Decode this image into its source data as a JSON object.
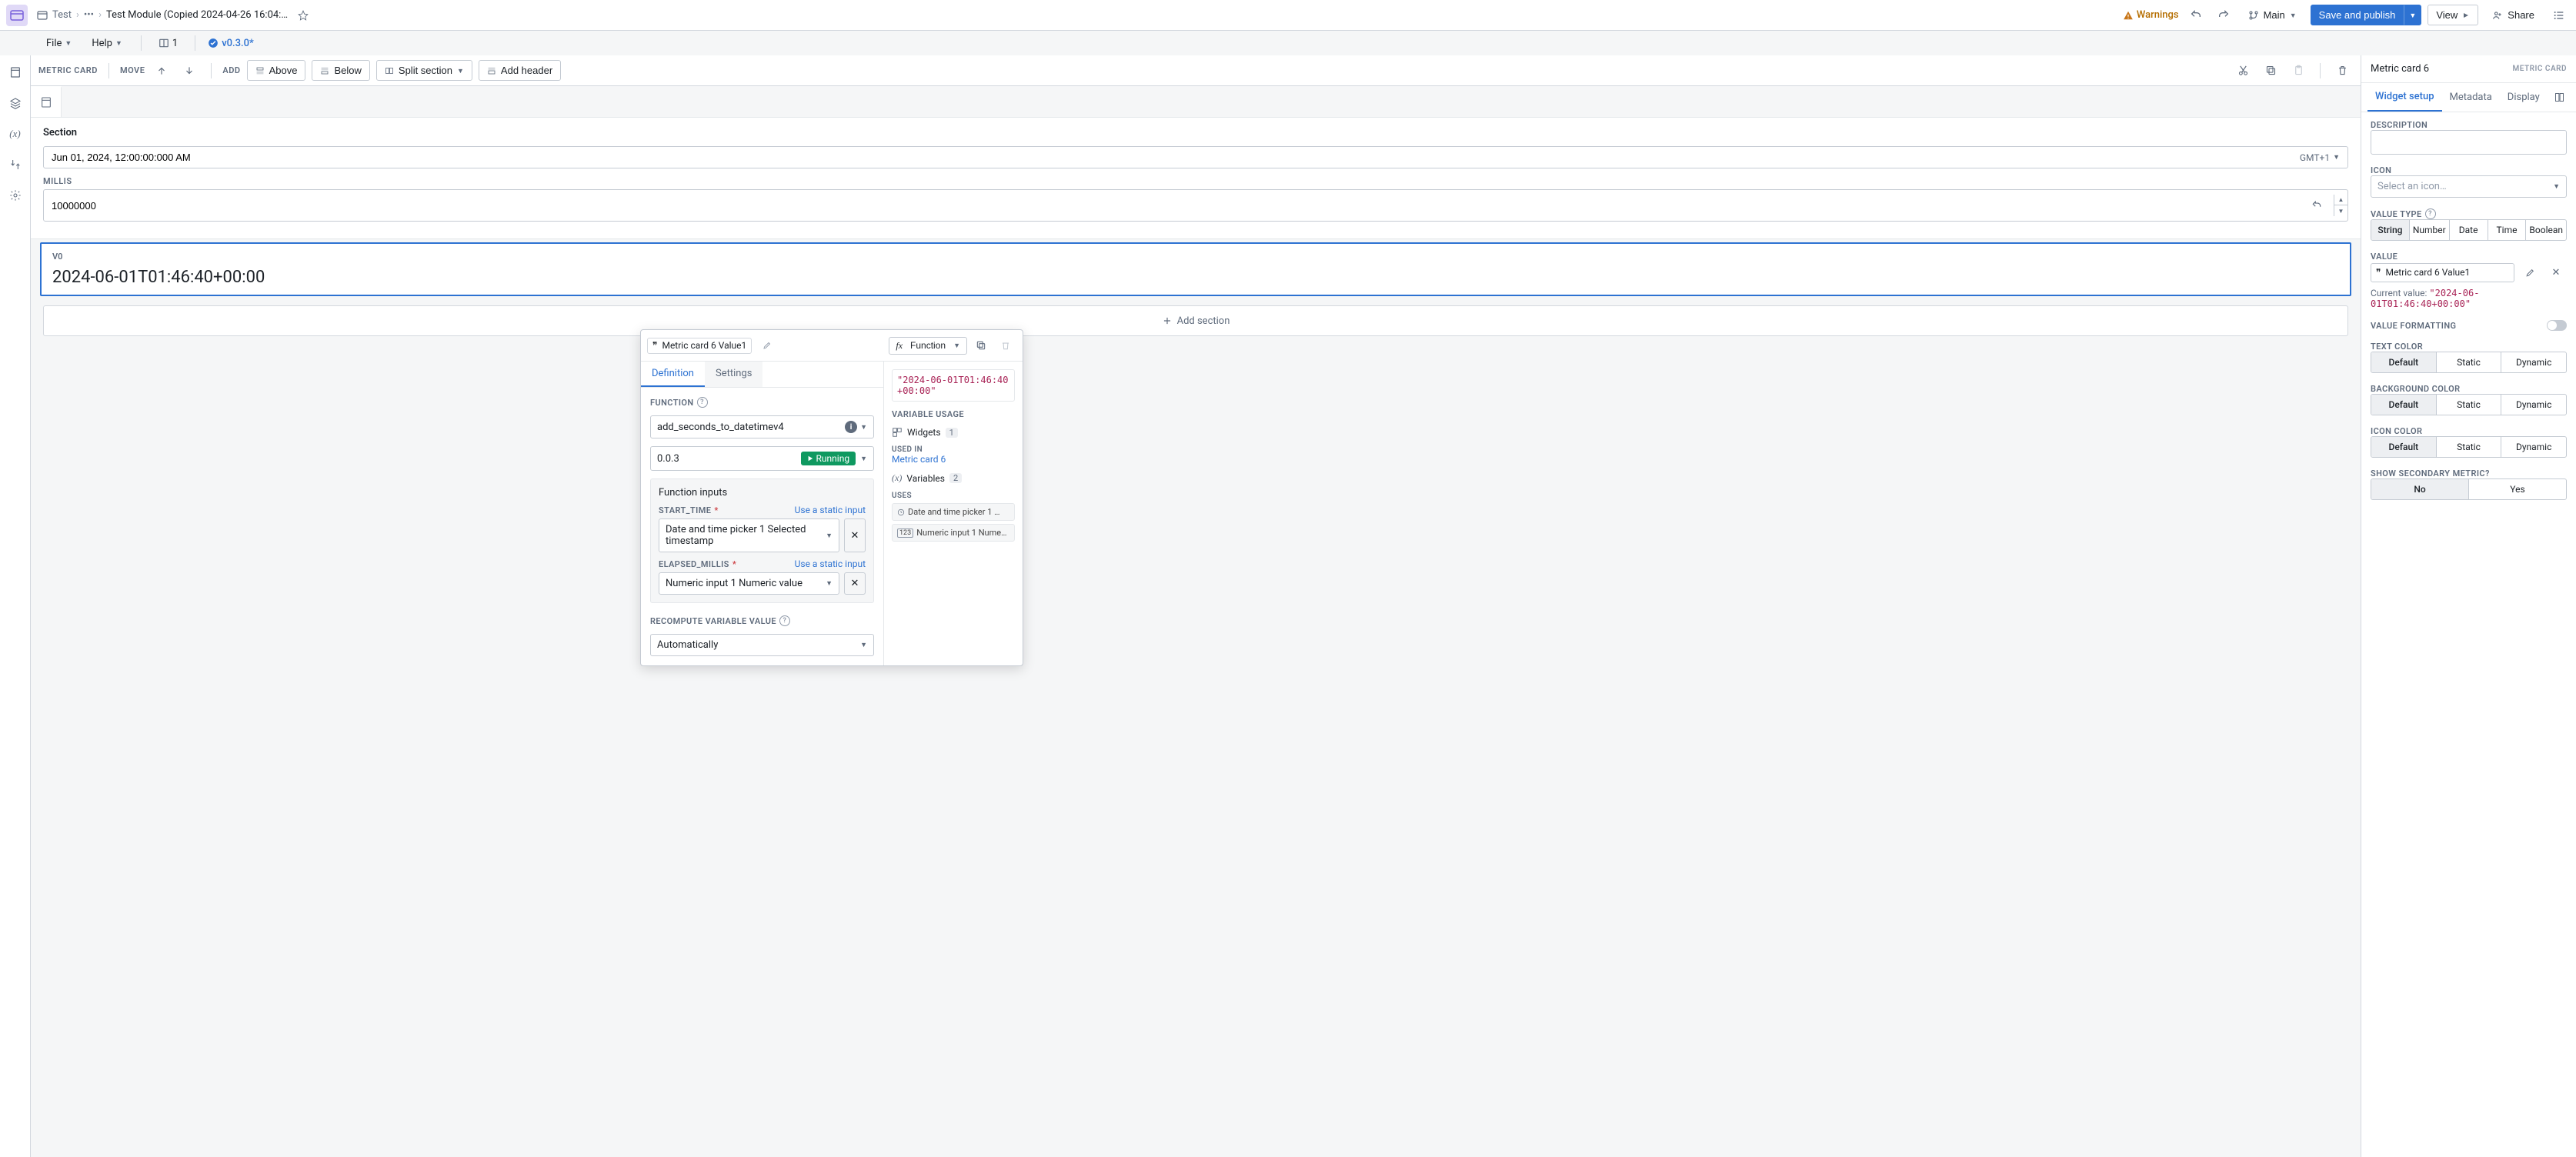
{
  "breadcrumb": {
    "proj": "Test",
    "ellipsis": "•••",
    "module": "Test Module (Copied 2024-04-26 16:04:…"
  },
  "menu": {
    "file": "File",
    "help": "Help",
    "panes": "1",
    "version": "v0.3.0*"
  },
  "header": {
    "warnings": "Warnings",
    "branch": "Main",
    "save": "Save and publish",
    "view": "View",
    "share": "Share"
  },
  "toolbar": {
    "widget": "METRIC CARD",
    "move": "MOVE",
    "add": "ADD",
    "above": "Above",
    "below": "Below",
    "split": "Split section",
    "header": "Add header"
  },
  "section": {
    "title": "Section",
    "date_value": "Jun 01, 2024, 12:00:00:000 AM",
    "tz": "GMT+1",
    "millis_label": "MILLIS",
    "millis_value": "10000000",
    "v0_label": "V0",
    "v0_value": "2024-06-01T01:46:40+00:00",
    "add_section": "Add section"
  },
  "popover": {
    "title": "Metric card 6 Value1",
    "type_label": "Function",
    "tabs": {
      "def": "Definition",
      "settings": "Settings"
    },
    "function_label": "FUNCTION",
    "function_name": "add_seconds_to_datetimev4",
    "version": "0.0.3",
    "running": "Running",
    "inputs_title": "Function inputs",
    "start_time_label": "START_TIME",
    "start_time_value": "Date and time picker 1 Selected timestamp",
    "use_static": "Use a static input",
    "elapsed_label": "ELAPSED_MILLIS",
    "elapsed_value": "Numeric input 1 Numeric value",
    "recompute_label": "RECOMPUTE VARIABLE VALUE",
    "recompute_value": "Automatically",
    "eval_value": "\"2024-06-01T01:46:40+00:00\"",
    "usage_label": "VARIABLE USAGE",
    "widgets_label": "Widgets",
    "widgets_count": "1",
    "used_in": "USED IN",
    "used_in_link": "Metric card 6",
    "variables_label": "Variables",
    "variables_count": "2",
    "uses_label": "USES",
    "uses_1": "Date and time picker 1 …",
    "uses_2": "Numeric input 1 Nume…"
  },
  "rightpanel": {
    "title": "Metric card 6",
    "type": "METRIC CARD",
    "tabs": {
      "widget": "Widget setup",
      "metadata": "Metadata",
      "display": "Display"
    },
    "desc_label": "DESCRIPTION",
    "icon_label": "ICON",
    "icon_placeholder": "Select an icon…",
    "valuetype_label": "VALUE TYPE",
    "vt": {
      "string": "String",
      "number": "Number",
      "date": "Date",
      "time": "Time",
      "bool": "Boolean"
    },
    "value_label": "VALUE",
    "value_chip": "Metric card 6 Value1",
    "curval_label": "Current value:",
    "curval": "\"2024-06-01T01:46:40+00:00\"",
    "formatting_label": "VALUE FORMATTING",
    "textcolor_label": "TEXT COLOR",
    "bgcolor_label": "BACKGROUND COLOR",
    "iconcolor_label": "ICON COLOR",
    "opts": {
      "default": "Default",
      "static": "Static",
      "dynamic": "Dynamic"
    },
    "secondary_label": "SHOW SECONDARY METRIC?",
    "no": "No",
    "yes": "Yes"
  }
}
